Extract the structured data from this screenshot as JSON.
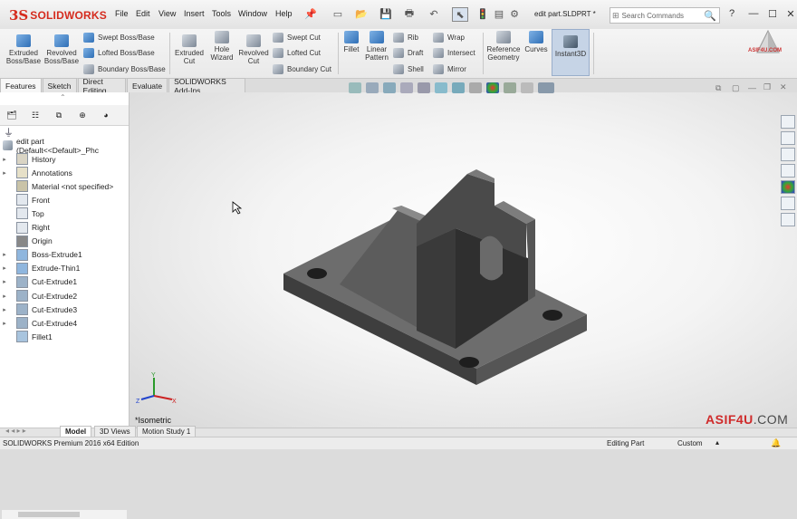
{
  "app": {
    "brand_ds": "3S",
    "brand_name": "SOLIDWORKS",
    "document_title": "edit part.SLDPRT *"
  },
  "menu": [
    "File",
    "Edit",
    "View",
    "Insert",
    "Tools",
    "Window",
    "Help"
  ],
  "search": {
    "placeholder": "Search Commands"
  },
  "ribbon": {
    "extruded_boss": "Extruded\nBoss/Base",
    "revolved_boss": "Revolved\nBoss/Base",
    "swept_boss": "Swept Boss/Base",
    "lofted_boss": "Lofted Boss/Base",
    "boundary_boss": "Boundary Boss/Base",
    "extruded_cut": "Extruded\nCut",
    "hole_wizard": "Hole\nWizard",
    "revolved_cut": "Revolved\nCut",
    "swept_cut": "Swept Cut",
    "lofted_cut": "Lofted Cut",
    "boundary_cut": "Boundary Cut",
    "fillet": "Fillet",
    "linear_pattern": "Linear\nPattern",
    "rib": "Rib",
    "draft": "Draft",
    "shell": "Shell",
    "wrap": "Wrap",
    "intersect": "Intersect",
    "mirror": "Mirror",
    "reference_geometry": "Reference\nGeometry",
    "curves": "Curves",
    "instant3d": "Instant3D"
  },
  "tabs": [
    "Features",
    "Sketch",
    "Direct Editing",
    "Evaluate",
    "SOLIDWORKS Add-Ins"
  ],
  "tree": {
    "root": "edit part  (Default<<Default>_Phc",
    "items": [
      {
        "label": "History",
        "expand": true,
        "icon": "history-icon"
      },
      {
        "label": "Annotations",
        "expand": true,
        "icon": "annotations-icon"
      },
      {
        "label": "Material <not specified>",
        "expand": false,
        "icon": "material-icon"
      },
      {
        "label": "Front",
        "expand": false,
        "icon": "plane-icon"
      },
      {
        "label": "Top",
        "expand": false,
        "icon": "plane-icon"
      },
      {
        "label": "Right",
        "expand": false,
        "icon": "plane-icon"
      },
      {
        "label": "Origin",
        "expand": false,
        "icon": "origin-icon"
      },
      {
        "label": "Boss-Extrude1",
        "expand": true,
        "icon": "boss-extrude-icon"
      },
      {
        "label": "Extrude-Thin1",
        "expand": true,
        "icon": "extrude-thin-icon"
      },
      {
        "label": "Cut-Extrude1",
        "expand": true,
        "icon": "cut-extrude-icon"
      },
      {
        "label": "Cut-Extrude2",
        "expand": true,
        "icon": "cut-extrude-icon"
      },
      {
        "label": "Cut-Extrude3",
        "expand": true,
        "icon": "cut-extrude-icon"
      },
      {
        "label": "Cut-Extrude4",
        "expand": true,
        "icon": "cut-extrude-icon"
      },
      {
        "label": "Fillet1",
        "expand": false,
        "icon": "fillet-icon"
      }
    ]
  },
  "viewport": {
    "view_label": "*Isometric",
    "triad": {
      "x": "X",
      "y": "Y",
      "z": "Z"
    }
  },
  "bottom_tabs": [
    "Model",
    "3D Views",
    "Motion Study 1"
  ],
  "status": {
    "edition": "SOLIDWORKS Premium 2016 x64 Edition",
    "mode": "Editing Part",
    "units": "Custom"
  },
  "watermark": {
    "logo_text": "ASIF4U.COM",
    "bottom_a": "ASIF4U",
    "bottom_b": ".COM"
  },
  "colors": {
    "brand_red": "#d52b1e",
    "accent_blue": "#3b6fc2",
    "part_gray": "#4a4a4a"
  }
}
